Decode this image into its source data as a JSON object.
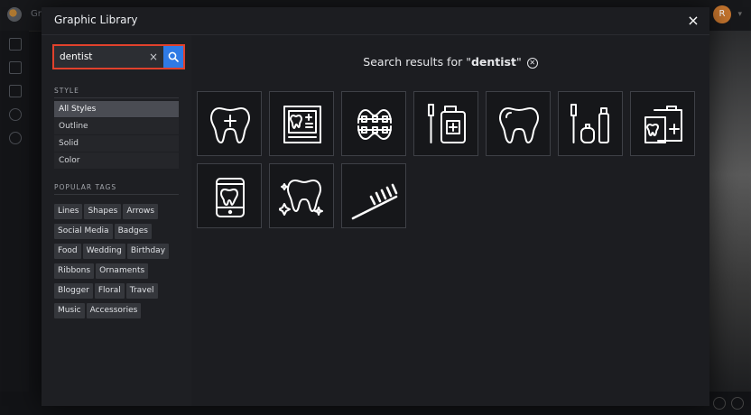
{
  "background": {
    "brand": "Gr",
    "avatar_initial": "R"
  },
  "modal": {
    "title": "Graphic Library",
    "close_glyph": "×"
  },
  "search": {
    "value": "dentist",
    "clear_glyph": "×",
    "button_icon": "search-icon"
  },
  "style_section": {
    "label": "STYLE",
    "items": [
      {
        "label": "All Styles",
        "active": true
      },
      {
        "label": "Outline",
        "active": false
      },
      {
        "label": "Solid",
        "active": false
      },
      {
        "label": "Color",
        "active": false
      }
    ]
  },
  "tags_section": {
    "label": "POPULAR TAGS",
    "rows": [
      [
        "Lines",
        "Shapes",
        "Arrows"
      ],
      [
        "Social Media",
        "Badges"
      ],
      [
        "Food",
        "Wedding",
        "Birthday"
      ],
      [
        "Ribbons",
        "Ornaments"
      ],
      [
        "Blogger",
        "Floral",
        "Travel"
      ],
      [
        "Music",
        "Accessories"
      ]
    ]
  },
  "results": {
    "heading_prefix": "Search results for \"",
    "query": "dentist",
    "heading_suffix": "\"",
    "clear_icon": "circle-x-icon",
    "items": [
      {
        "icon": "tooth-with-cross-icon"
      },
      {
        "icon": "dental-chart-icon"
      },
      {
        "icon": "braces-teeth-icon"
      },
      {
        "icon": "toothbrush-mouthwash-icon"
      },
      {
        "icon": "tooth-icon"
      },
      {
        "icon": "toothbrush-floss-toothpaste-icon"
      },
      {
        "icon": "dental-kit-bag-icon"
      },
      {
        "icon": "tooth-tablet-icon"
      },
      {
        "icon": "sparkling-tooth-icon"
      },
      {
        "icon": "toothbrush-icon"
      }
    ]
  },
  "colors": {
    "accent_blue": "#2f7ae5",
    "focus_red": "#e1412c",
    "modal_bg": "#1c1d21"
  }
}
